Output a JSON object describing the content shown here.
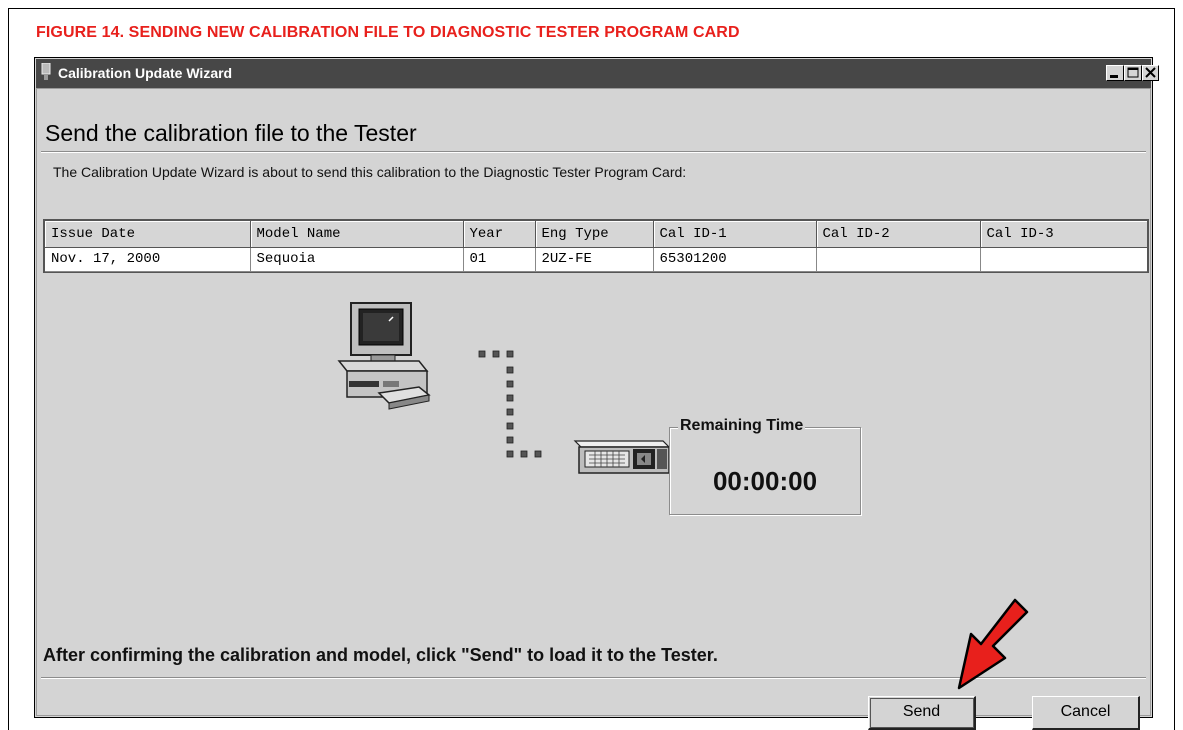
{
  "figure_caption": "FIGURE 14.  SENDING NEW CALIBRATION FILE TO DIAGNOSTIC TESTER PROGRAM CARD",
  "window": {
    "title": "Calibration Update Wizard",
    "controls": [
      "minimize",
      "maximize",
      "close"
    ]
  },
  "heading": "Send the calibration file to the Tester",
  "intro": "The Calibration Update Wizard is about to send this calibration to the Diagnostic Tester Program Card:",
  "table": {
    "headers": [
      "Issue Date",
      "Model Name",
      "Year",
      "Eng Type",
      "Cal ID-1",
      "Cal ID-2",
      "Cal ID-3"
    ],
    "rows": [
      [
        "Nov. 17, 2000",
        "Sequoia",
        "01",
        "2UZ-FE",
        "65301200",
        "",
        ""
      ]
    ]
  },
  "remaining_time": {
    "label": "Remaining Time",
    "value": "00:00:00"
  },
  "instruction": "After confirming the calibration and model, click \"Send\" to load it to the Tester.",
  "buttons": {
    "send": "Send",
    "cancel": "Cancel"
  },
  "icons": [
    "computer-icon",
    "tester-card-icon",
    "connection-dots",
    "red-pointer-arrow-icon"
  ],
  "colors": {
    "caption_red": "#e8201c",
    "titlebar": "#474747",
    "window_bg": "#d4d4d4",
    "arrow_red": "#e8201c"
  }
}
